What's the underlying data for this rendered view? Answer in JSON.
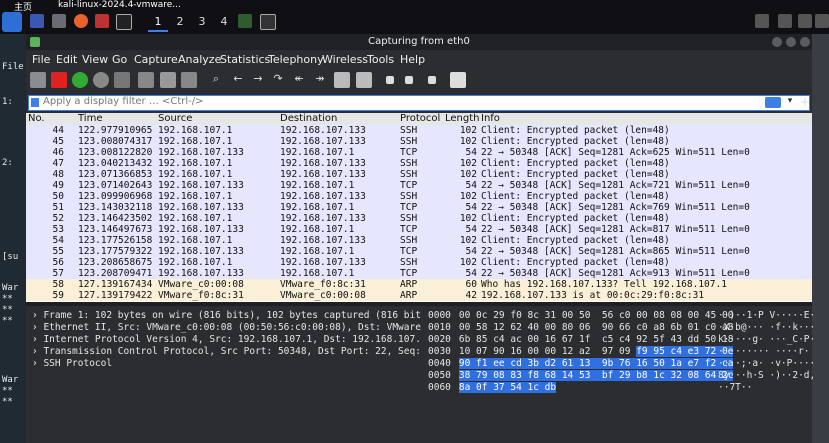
{
  "taskbar": {
    "tabs": [
      {
        "label": "主页"
      },
      {
        "label": "kali-linux-2024.4-vmware..."
      }
    ],
    "workspaces": [
      "1",
      "2",
      "3",
      "4"
    ]
  },
  "terminal_strip": {
    "lines": [
      "File",
      "1:",
      "2:",
      "[su",
      "War",
      "**",
      "**",
      "**",
      "War",
      "**",
      "**"
    ]
  },
  "window": {
    "title": "Capturing from eth0"
  },
  "menu": [
    "File",
    "Edit",
    "View",
    "Go",
    "Capture",
    "Analyze",
    "Statistics",
    "Telephony",
    "Wireless",
    "Tools",
    "Help"
  ],
  "filter": {
    "placeholder": "Apply a display filter … <Ctrl-/>"
  },
  "columns": [
    "No.",
    "Time",
    "Source",
    "Destination",
    "Protocol",
    "Length",
    "Info"
  ],
  "packets": [
    {
      "no": "44",
      "time": "122.977910965",
      "src": "192.168.107.1",
      "dst": "192.168.107.133",
      "proto": "SSH",
      "len": "102",
      "info": "Client: Encrypted packet (len=48)",
      "color": "#e7e6ff"
    },
    {
      "no": "45",
      "time": "123.008074317",
      "src": "192.168.107.1",
      "dst": "192.168.107.133",
      "proto": "SSH",
      "len": "102",
      "info": "Client: Encrypted packet (len=48)",
      "color": "#e7e6ff"
    },
    {
      "no": "46",
      "time": "123.008122820",
      "src": "192.168.107.133",
      "dst": "192.168.107.1",
      "proto": "TCP",
      "len": "54",
      "info": "22 → 50348 [ACK] Seq=1281 Ack=625 Win=511 Len=0",
      "color": "#e7e6ff"
    },
    {
      "no": "47",
      "time": "123.040213432",
      "src": "192.168.107.1",
      "dst": "192.168.107.133",
      "proto": "SSH",
      "len": "102",
      "info": "Client: Encrypted packet (len=48)",
      "color": "#e7e6ff"
    },
    {
      "no": "48",
      "time": "123.071366853",
      "src": "192.168.107.1",
      "dst": "192.168.107.133",
      "proto": "SSH",
      "len": "102",
      "info": "Client: Encrypted packet (len=48)",
      "color": "#e7e6ff"
    },
    {
      "no": "49",
      "time": "123.071402643",
      "src": "192.168.107.133",
      "dst": "192.168.107.1",
      "proto": "TCP",
      "len": "54",
      "info": "22 → 50348 [ACK] Seq=1281 Ack=721 Win=511 Len=0",
      "color": "#e7e6ff"
    },
    {
      "no": "50",
      "time": "123.099906968",
      "src": "192.168.107.1",
      "dst": "192.168.107.133",
      "proto": "SSH",
      "len": "102",
      "info": "Client: Encrypted packet (len=48)",
      "color": "#e7e6ff"
    },
    {
      "no": "51",
      "time": "123.143032118",
      "src": "192.168.107.133",
      "dst": "192.168.107.1",
      "proto": "TCP",
      "len": "54",
      "info": "22 → 50348 [ACK] Seq=1281 Ack=769 Win=511 Len=0",
      "color": "#e7e6ff"
    },
    {
      "no": "52",
      "time": "123.146423502",
      "src": "192.168.107.1",
      "dst": "192.168.107.133",
      "proto": "SSH",
      "len": "102",
      "info": "Client: Encrypted packet (len=48)",
      "color": "#e7e6ff"
    },
    {
      "no": "53",
      "time": "123.146497673",
      "src": "192.168.107.133",
      "dst": "192.168.107.1",
      "proto": "TCP",
      "len": "54",
      "info": "22 → 50348 [ACK] Seq=1281 Ack=817 Win=511 Len=0",
      "color": "#e7e6ff"
    },
    {
      "no": "54",
      "time": "123.177526158",
      "src": "192.168.107.1",
      "dst": "192.168.107.133",
      "proto": "SSH",
      "len": "102",
      "info": "Client: Encrypted packet (len=48)",
      "color": "#e7e6ff"
    },
    {
      "no": "55",
      "time": "123.177579322",
      "src": "192.168.107.133",
      "dst": "192.168.107.1",
      "proto": "TCP",
      "len": "54",
      "info": "22 → 50348 [ACK] Seq=1281 Ack=865 Win=511 Len=0",
      "color": "#e7e6ff"
    },
    {
      "no": "56",
      "time": "123.208658675",
      "src": "192.168.107.1",
      "dst": "192.168.107.133",
      "proto": "SSH",
      "len": "102",
      "info": "Client: Encrypted packet (len=48)",
      "color": "#e7e6ff"
    },
    {
      "no": "57",
      "time": "123.208709471",
      "src": "192.168.107.133",
      "dst": "192.168.107.1",
      "proto": "TCP",
      "len": "54",
      "info": "22 → 50348 [ACK] Seq=1281 Ack=913 Win=511 Len=0",
      "color": "#e7e6ff"
    },
    {
      "no": "58",
      "time": "127.139167434",
      "src": "VMware_c0:00:08",
      "dst": "VMware_f0:8c:31",
      "proto": "ARP",
      "len": "60",
      "info": "Who has 192.168.107.133? Tell 192.168.107.1",
      "color": "#faf0d7"
    },
    {
      "no": "59",
      "time": "127.139179422",
      "src": "VMware_f0:8c:31",
      "dst": "VMware_c0:00:08",
      "proto": "ARP",
      "len": "42",
      "info": "192.168.107.133 is at 00:0c:29:f0:8c:31",
      "color": "#faf0d7"
    }
  ],
  "details": [
    "Frame 1: 102 bytes on wire (816 bits), 102 bytes captured (816 bit",
    "Ethernet II, Src: VMware_c0:00:08 (00:50:56:c0:00:08), Dst: VMware",
    "Internet Protocol Version 4, Src: 192.168.107.1, Dst: 192.168.107.",
    "Transmission Control Protocol, Src Port: 50348, Dst Port: 22, Seq:",
    "SSH Protocol"
  ],
  "hex": [
    {
      "off": "0000",
      "pre": "00 0c 29 f0 8c 31 00 50  56 c0 00 08 08 00 45 00",
      "sel": "",
      "ascii": "··)··1·P V·····E·"
    },
    {
      "off": "0010",
      "pre": "00 58 12 62 40 00 80 06  90 66 c0 a8 6b 01 c0 a8",
      "sel": "",
      "ascii": "·X·b@··· ·f··k···"
    },
    {
      "off": "0020",
      "pre": "6b 85 c4 ac 00 16 67 1f  c5 c4 92 5f 43 dd 50 18",
      "sel": "",
      "ascii": "k·····g· ···_C·P·"
    },
    {
      "off": "0030",
      "pre": "10 07 90 16 00 00 12 a2  97 09 ",
      "sel": "f9 95 c4 e3 72 0e",
      "ascii": "·········  ····r·"
    },
    {
      "off": "0040",
      "pre": "",
      "sel": "90 f1 ee cd 3b d2 61 13  9b 76 16 50 1a e7 f2 ca",
      "ascii": "····;·a· ·v·P····"
    },
    {
      "off": "0050",
      "pre": "",
      "sel": "38 79 08 83 f8 68 14 53  bf 29 b8 1c 32 08 64 2c",
      "ascii": "8y···h·S ·)··2·d,"
    },
    {
      "off": "0060",
      "pre": "",
      "sel": "8a 0f 37 54 1c db",
      "ascii": "··7T··"
    }
  ]
}
